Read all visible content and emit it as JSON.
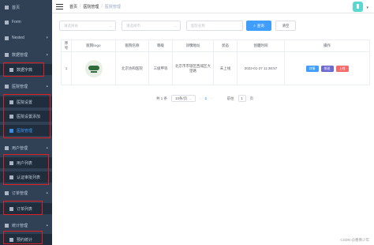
{
  "sidebar": {
    "items": [
      {
        "label": "首页",
        "kind": "group",
        "arrow": ""
      },
      {
        "label": "Form",
        "kind": "group",
        "arrow": ""
      },
      {
        "label": "Nested",
        "kind": "group",
        "arrow": "▾"
      },
      {
        "label": "数据管理",
        "kind": "group",
        "arrow": "▴"
      },
      {
        "label": "数据字典",
        "kind": "child",
        "arrow": ""
      },
      {
        "label": "医院管理",
        "kind": "group",
        "arrow": "▴"
      },
      {
        "label": "医院设置",
        "kind": "child",
        "arrow": ""
      },
      {
        "label": "医院设置添加",
        "kind": "child",
        "arrow": ""
      },
      {
        "label": "医院管理",
        "kind": "child-active",
        "arrow": ""
      },
      {
        "label": "用户管理",
        "kind": "group",
        "arrow": "▴"
      },
      {
        "label": "用户列表",
        "kind": "child",
        "arrow": ""
      },
      {
        "label": "认证审批列表",
        "kind": "child",
        "arrow": ""
      },
      {
        "label": "订单管理",
        "kind": "group",
        "arrow": "▴"
      },
      {
        "label": "订单列表",
        "kind": "child",
        "arrow": ""
      },
      {
        "label": "统计管理",
        "kind": "group",
        "arrow": "▴"
      },
      {
        "label": "预约统计",
        "kind": "child",
        "arrow": ""
      }
    ]
  },
  "breadcrumb": {
    "home": "首页",
    "parent": "医院管理",
    "current": "医院管理",
    "sep": "/"
  },
  "search": {
    "province_placeholder": "请选择省",
    "city_placeholder": "请选择市",
    "name_placeholder": "医院名称",
    "query_label": "查询",
    "clear_label": "清空",
    "dropdown_glyph": "⌄"
  },
  "table": {
    "headers": [
      "序号",
      "医院logo",
      "医院名称",
      "等级",
      "详情地址",
      "状态",
      "创建时间",
      "操作"
    ],
    "rows": [
      {
        "index": "1",
        "name": "北京协和医院",
        "level": "三级甲等",
        "address": "北京市市辖区西城区大望路",
        "status": "未上线",
        "created": "2022-01-27 11:30:57",
        "ops": [
          "详情",
          "排班",
          "上线"
        ]
      }
    ]
  },
  "pager": {
    "total": "共 1 条",
    "page_size": "10条/页",
    "prev": "‹",
    "current": "1",
    "next": "›",
    "goto_label": "前往",
    "goto_value": "1",
    "page_label": "页"
  },
  "watermark": "CSDN @墨佛少年",
  "colors": {
    "sidebar_bg": "#304156",
    "accent": "#409eff",
    "danger": "#f56c6c",
    "highlight_border": "#e02020"
  }
}
